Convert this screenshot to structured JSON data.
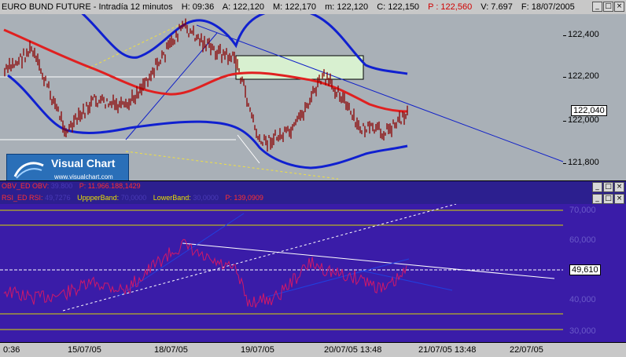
{
  "upper_window": {
    "title_parts": [
      "EURO BUND FUTURE - Intradía 12 minutos",
      "H: 09:36",
      "A: 122,120",
      "M: 122,170",
      "m: 122,120",
      "C: 122,150"
    ],
    "p_label": "P : 122,560",
    "volume": "V: 7.697",
    "date": "F: 18/07/2005",
    "buttons": [
      "_",
      "□",
      "×"
    ],
    "y_ticks": [
      "122,400",
      "122,200",
      "122,000",
      "121,800"
    ],
    "last_price": "122,040"
  },
  "logo": {
    "title": "Visual Chart",
    "url": "www.visualchart.com"
  },
  "obv_row": {
    "name": "OBV_ED",
    "label": "OBV:",
    "value": "39.800",
    "p_label": "P: 11.966.188,1429",
    "buttons": [
      "_",
      "□",
      "×"
    ]
  },
  "rsi_row": {
    "name": "RSI_ED",
    "label": "RSI:",
    "value": "49,7276",
    "upper_label": "UppperBand:",
    "upper_value": "70,0000",
    "lower_label": "LowerBand:",
    "lower_value": "30,0000",
    "p_label": "P: 139,0909",
    "buttons": [
      "_",
      "□",
      "×"
    ]
  },
  "lower_window": {
    "y_ticks": [
      "70,000",
      "60,000",
      "40,000",
      "30,000"
    ],
    "last_value": "49,610"
  },
  "x_axis": {
    "labels": [
      "0:36",
      "15/07/05",
      "18/07/05",
      "19/07/05",
      "20/07/05 13:48",
      "21/07/05 13:48",
      "22/07/05"
    ]
  },
  "colors": {
    "price_bg": "#a9b0b7",
    "rsi_bg": "#3a1ca8",
    "moving_average": "#e02020",
    "bollinger": "#1020d0",
    "price_bars": "#8b0000",
    "rsi_line": "#d01868"
  }
}
